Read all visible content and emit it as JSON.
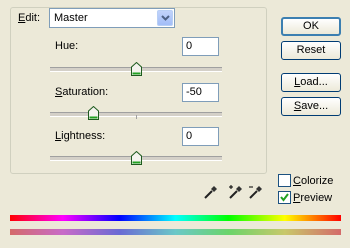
{
  "edit": {
    "label": "Edit:",
    "selected": "Master"
  },
  "hue": {
    "label": "Hue:",
    "value": "0",
    "level": 0
  },
  "saturation": {
    "label": "Saturation:",
    "value": "-50",
    "level": -50
  },
  "lightness": {
    "label": "Lightness:",
    "value": "0",
    "level": 0
  },
  "buttons": {
    "ok": "OK",
    "reset": "Reset",
    "load": "Load...",
    "save": "Save..."
  },
  "colorize": {
    "label": "Colorize",
    "checked": false
  },
  "preview": {
    "label": "Preview",
    "checked": true
  },
  "icons": [
    "chevron-down-icon",
    "eyedropper-icon",
    "eyedropper-plus-icon",
    "eyedropper-minus-icon",
    "check-icon"
  ],
  "colors": {
    "button_border": "#003c74",
    "field_border": "#7f9db9",
    "dialog_bg": "#ece9d8"
  }
}
